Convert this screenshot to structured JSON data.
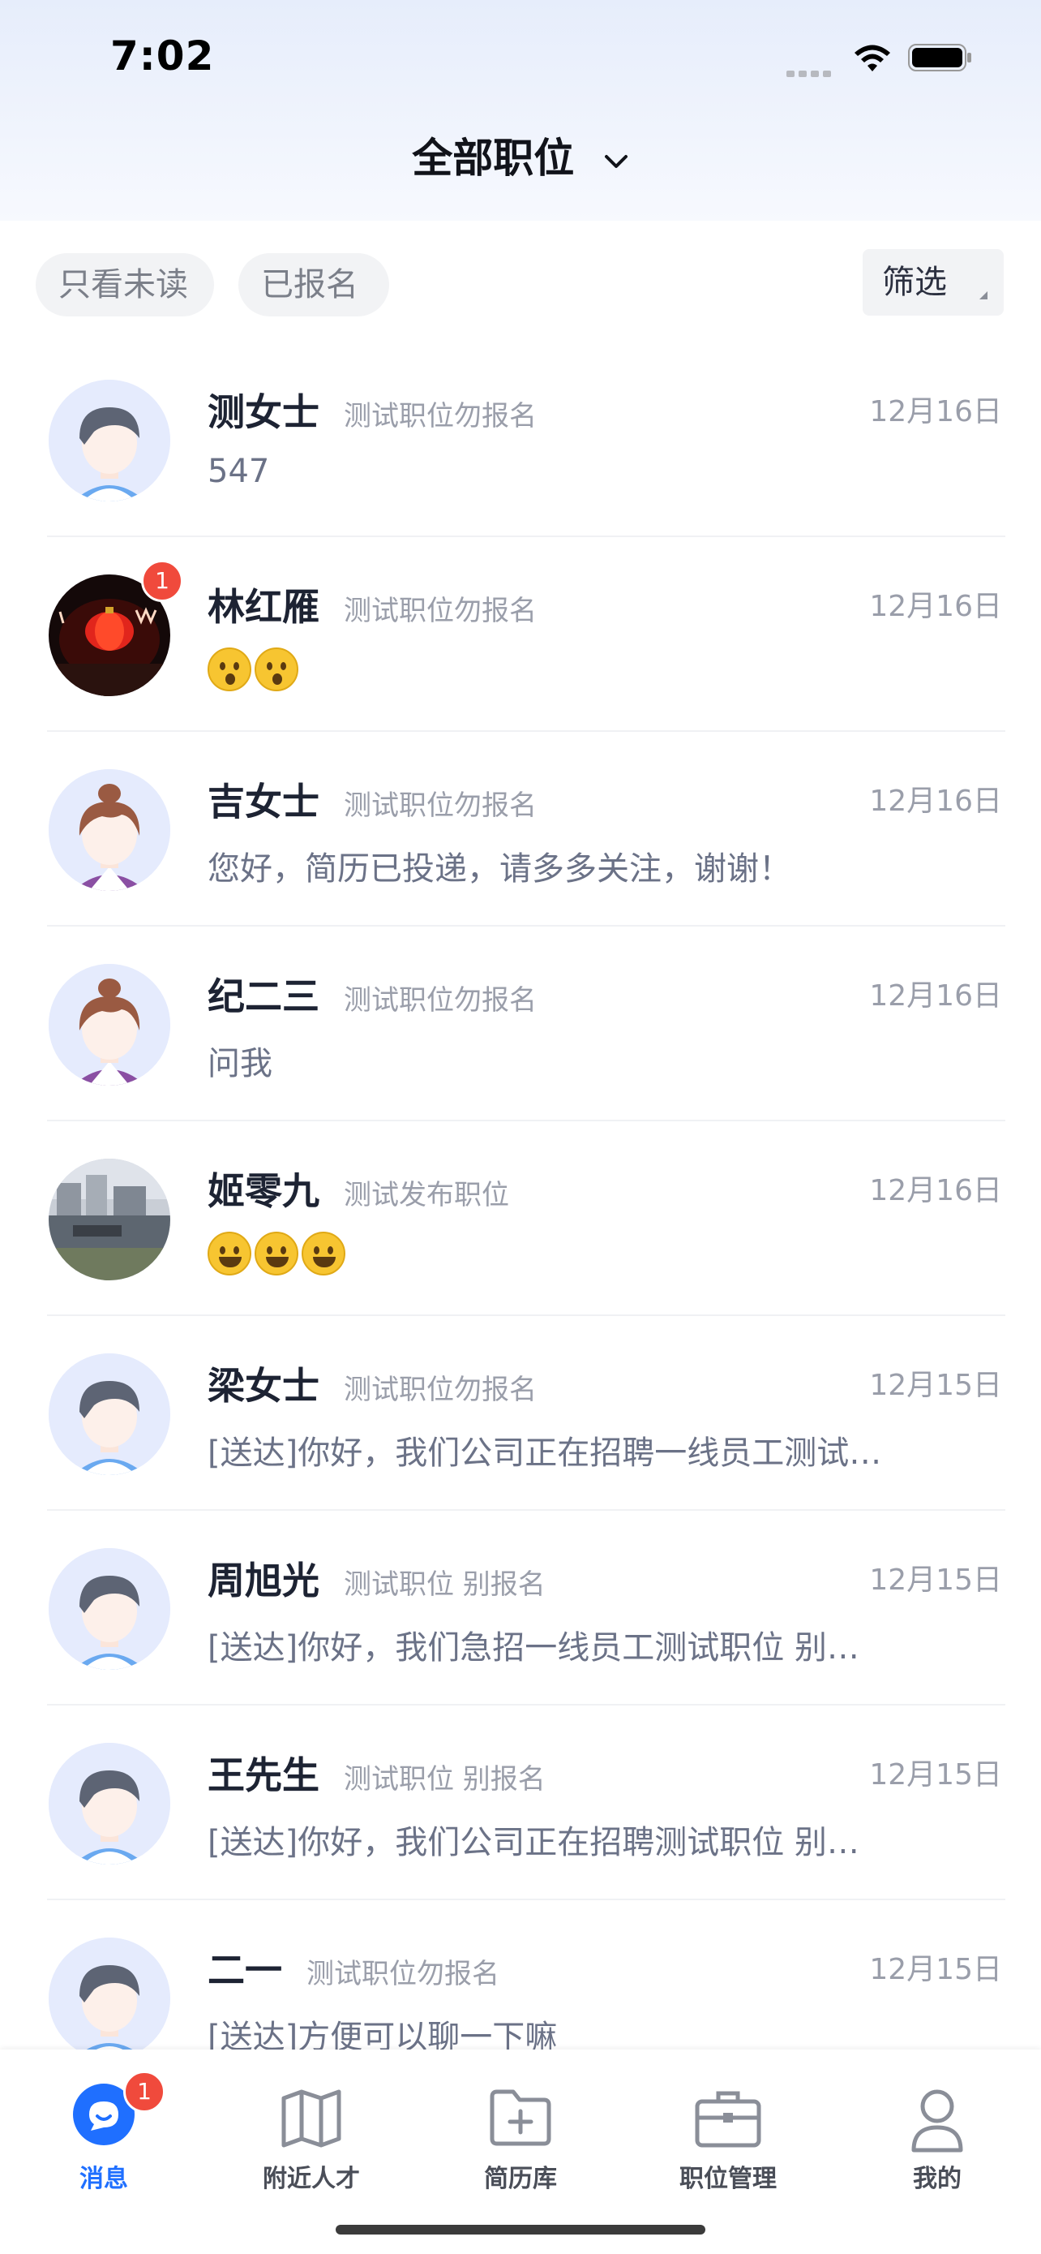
{
  "status_bar": {
    "time": "7:02"
  },
  "header": {
    "title": "全部职位"
  },
  "filters": {
    "unread": "只看未读",
    "applied": "已报名",
    "filter": "筛选"
  },
  "conversations": [
    {
      "name": "测女士",
      "job": "测试职位勿报名",
      "date": "12月16日",
      "message": "547",
      "badge": ""
    },
    {
      "name": "林红雁",
      "job": "测试职位勿报名",
      "date": "12月16日",
      "message": "",
      "badge": "1"
    },
    {
      "name": "吉女士",
      "job": "测试职位勿报名",
      "date": "12月16日",
      "message": "您好，简历已投递，请多多关注，谢谢！",
      "badge": ""
    },
    {
      "name": "纪二三",
      "job": "测试职位勿报名",
      "date": "12月16日",
      "message": "问我",
      "badge": ""
    },
    {
      "name": "姬零九",
      "job": "测试发布职位",
      "date": "12月16日",
      "message": "",
      "badge": ""
    },
    {
      "name": "梁女士",
      "job": "测试职位勿报名",
      "date": "12月15日",
      "message": "[送达]你好，我们公司正在招聘一线员工测试…",
      "badge": ""
    },
    {
      "name": "周旭光",
      "job": "测试职位 别报名",
      "date": "12月15日",
      "message": "[送达]你好，我们急招一线员工测试职位 别…",
      "badge": ""
    },
    {
      "name": "王先生",
      "job": "测试职位 别报名",
      "date": "12月15日",
      "message": "[送达]你好，我们公司正在招聘测试职位 别…",
      "badge": ""
    },
    {
      "name": "二一",
      "job": "测试职位勿报名",
      "date": "12月15日",
      "message": "[送达]方便可以聊一下嘛",
      "badge": ""
    }
  ],
  "tabbar": {
    "messages": "消息",
    "messages_badge": "1",
    "nearby": "附近人才",
    "resumes": "简历库",
    "jobs": "职位管理",
    "mine": "我的"
  },
  "colors": {
    "accent": "#1f6fff",
    "badge": "#f04a3c"
  }
}
